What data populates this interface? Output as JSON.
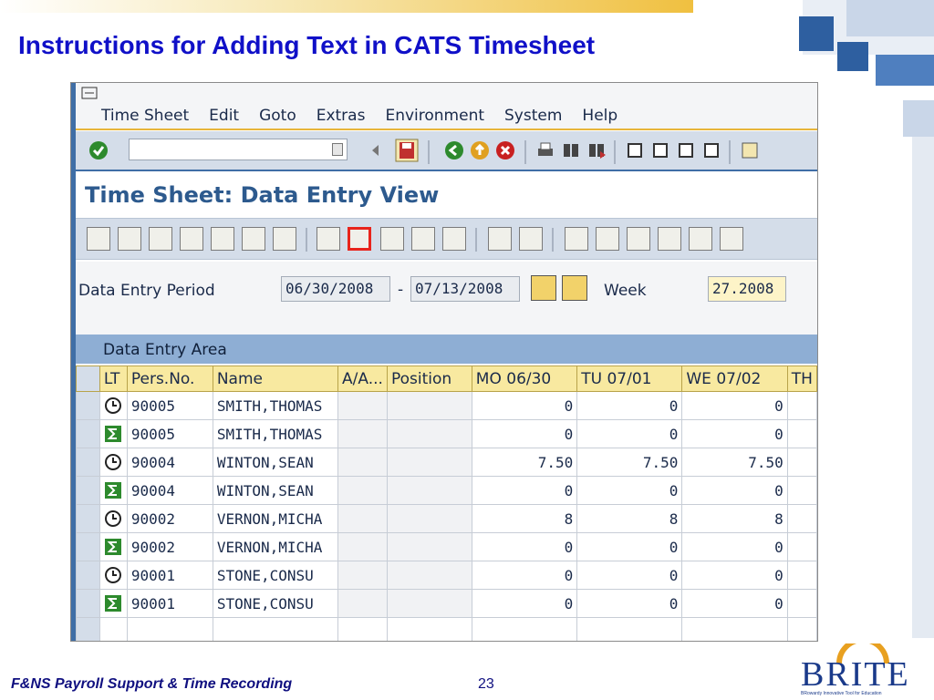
{
  "slide": {
    "title": "Instructions for Adding Text in CATS Timesheet",
    "footer_left": "F&NS Payroll Support & Time Recording",
    "page_number": "23",
    "logo": {
      "word": "BRITE",
      "tagline": "BRowardy Innovative Tool for Education"
    }
  },
  "sap": {
    "menu": [
      "Time Sheet",
      "Edit",
      "Goto",
      "Extras",
      "Environment",
      "System",
      "Help"
    ],
    "command_field": "",
    "screen_title": "Time Sheet: Data Entry View",
    "params": {
      "period_label": "Data Entry Period",
      "period_from": "06/30/2008",
      "period_sep": "-",
      "period_to": "07/13/2008",
      "week_label": "Week",
      "week_value": "27.2008"
    },
    "area_title": "Data Entry Area",
    "table": {
      "headers": [
        "LT",
        "Pers.No.",
        "Name",
        "A/A...",
        "Position",
        "MO  06/30",
        "TU  07/01",
        "WE  07/02",
        "TH"
      ],
      "rows": [
        {
          "icon": "clock-icon",
          "pers": "90005",
          "name": "SMITH,THOMAS",
          "mo": "0",
          "tu": "0",
          "we": "0"
        },
        {
          "icon": "sum-icon",
          "pers": "90005",
          "name": "SMITH,THOMAS",
          "mo": "0",
          "tu": "0",
          "we": "0"
        },
        {
          "icon": "clock-icon",
          "pers": "90004",
          "name": "WINTON,SEAN",
          "mo": "7.50",
          "tu": "7.50",
          "we": "7.50"
        },
        {
          "icon": "sum-icon",
          "pers": "90004",
          "name": "WINTON,SEAN",
          "mo": "0",
          "tu": "0",
          "we": "0"
        },
        {
          "icon": "clock-icon",
          "pers": "90002",
          "name": "VERNON,MICHA",
          "mo": "8",
          "tu": "8",
          "we": "8"
        },
        {
          "icon": "sum-icon",
          "pers": "90002",
          "name": "VERNON,MICHA",
          "mo": "0",
          "tu": "0",
          "we": "0"
        },
        {
          "icon": "clock-icon",
          "pers": "90001",
          "name": "STONE,CONSU",
          "mo": "0",
          "tu": "0",
          "we": "0"
        },
        {
          "icon": "sum-icon",
          "pers": "90001",
          "name": "STONE,CONSU",
          "mo": "0",
          "tu": "0",
          "we": "0"
        }
      ]
    },
    "colors": {
      "accent_blue": "#3f6ea6",
      "header_yellow": "#f8e9a0",
      "highlight_red": "#e8241c"
    }
  }
}
